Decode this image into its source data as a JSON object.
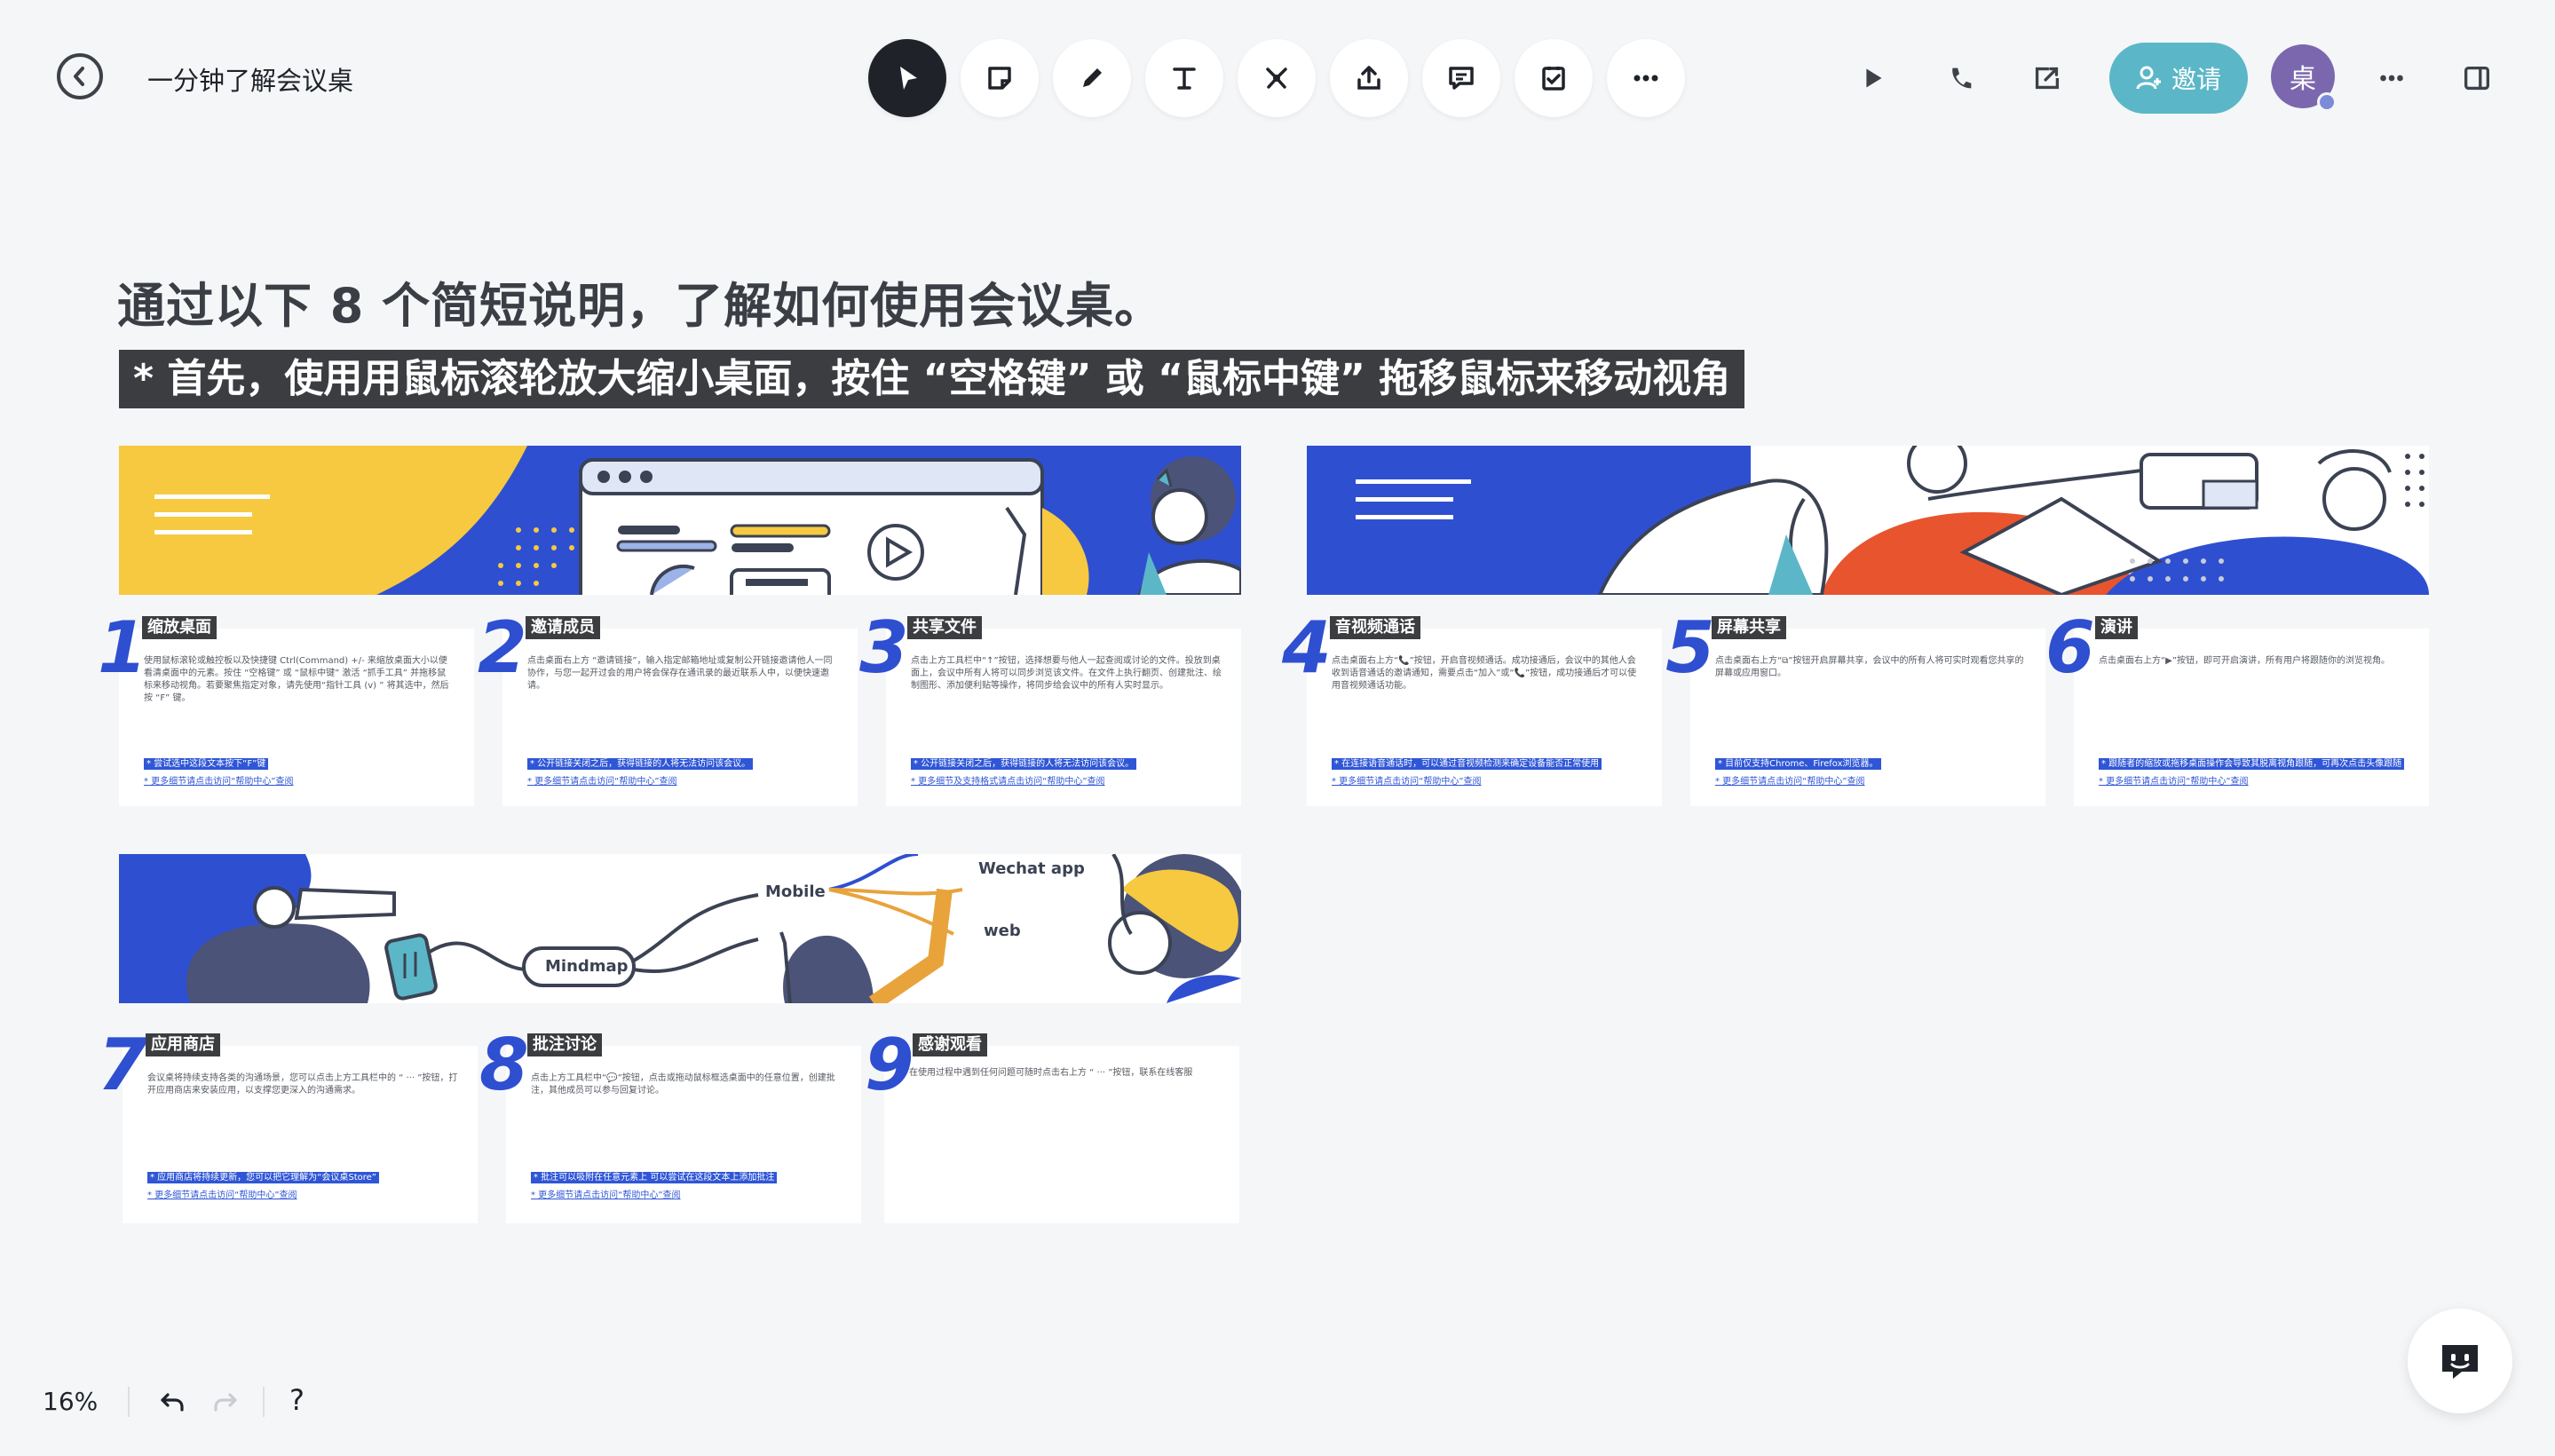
{
  "header": {
    "doc_title": "一分钟了解会议桌",
    "invite_label": "邀请",
    "avatar_char": "桌"
  },
  "toolbar": {
    "tools": [
      "pointer-icon",
      "sticky-note-icon",
      "pen-icon",
      "text-icon",
      "connector-icon",
      "upload-icon",
      "comment-icon",
      "checklist-icon",
      "more-icon"
    ]
  },
  "intro": {
    "headline": "通过以下 8 个简短说明，了解如何使用会议桌。",
    "tip": "* 首先，使用用鼠标滚轮放大缩小桌面，按住 “空格键” 或 “鼠标中键” 拖移鼠标来移动视角"
  },
  "banners": {
    "mindmap_labels": {
      "center": "Mindmap",
      "mobile": "Mobile",
      "wechat": "Wechat app",
      "web": "web"
    }
  },
  "cards": [
    {
      "num": "1",
      "title": "缩放桌面",
      "desc": "使用鼠标滚轮或触控板以及快捷键 Ctrl(Command) +/- 来缩放桌面大小以便看清桌面中的元素。按住 “空格键” 或 “鼠标中键” 激活 “抓手工具” 并拖移鼠标来移动视角。若要聚焦指定对象，请先使用“指针工具 (v) ” 将其选中，然后按 “F” 键。",
      "hl": "* 尝试选中这段文本按下“F”键",
      "link": "* 更多细节请点击访问“帮助中心”查阅"
    },
    {
      "num": "2",
      "title": "邀请成员",
      "desc": "点击桌面右上方 “邀请链接”，输入指定邮箱地址或复制公开链接邀请他人一同协作，与您一起开过会的用户将会保存在通讯录的最近联系人中，以便快速邀请。",
      "hl": "* 公开链接关闭之后，获得链接的人将无法访问该会议。",
      "link": "* 更多细节请点击访问“帮助中心”查阅"
    },
    {
      "num": "3",
      "title": "共享文件",
      "desc": "点击上方工具栏中“↑”按钮，选择想要与他人一起查阅或讨论的文件。投放到桌面上，会议中所有人将可以同步浏览该文件。在文件上执行翻页、创建批注、绘制图形、添加便利贴等操作，将同步给会议中的所有人实时显示。",
      "hl": "* 公开链接关闭之后，获得链接的人将无法访问该会议。",
      "link": "* 更多细节及支持格式请点击访问“帮助中心”查阅"
    },
    {
      "num": "4",
      "title": "音视频通话",
      "desc": "点击桌面右上方“📞”按钮，开启音视频通话。成功接通后，会议中的其他人会收到语音通话的邀请通知，需要点击“加入”或“📞”按钮，成功接通后才可以使用音视频通话功能。",
      "hl": "* 在连接语音通话时，可以通过音视频检测来确定设备能否正常使用",
      "link": "* 更多细节请点击访问“帮助中心”查阅"
    },
    {
      "num": "5",
      "title": "屏幕共享",
      "desc": "点击桌面右上方“⧉”按钮开启屏幕共享，会议中的所有人将可实时观看您共享的屏幕或应用窗口。",
      "hl": "* 目前仅支持Chrome、Firefox浏览器。",
      "link": "* 更多细节请点击访问“帮助中心”查阅"
    },
    {
      "num": "6",
      "title": "演讲",
      "desc": "点击桌面右上方“▶”按钮，即可开启演讲，所有用户将跟随你的浏览视角。",
      "hl": "* 跟随者的缩放或拖移桌面操作会导致其脱离视角跟随，可再次点击头像跟随",
      "link": "* 更多细节请点击访问“帮助中心”查阅"
    },
    {
      "num": "7",
      "title": "应用商店",
      "desc": "会议桌将持续支持各类的沟通场景，您可以点击上方工具栏中的 “ ··· ”按钮，打开应用商店来安装应用，以支撑您更深入的沟通需求。",
      "hl": "* 应用商店将持续更新，您可以把它理解为“会议桌Store”",
      "link": "* 更多细节请点击访问“帮助中心”查阅"
    },
    {
      "num": "8",
      "title": "批注讨论",
      "desc": "点击上方工具栏中“💬”按钮，点击或拖动鼠标框选桌面中的任意位置，创建批注，其他成员可以参与回复讨论。",
      "hl": "* 批注可以吸附在任意元素上 可以尝试在这段文本上添加批注",
      "link": "* 更多细节请点击访问“帮助中心”查阅"
    },
    {
      "num": "9",
      "title": "感谢观看",
      "desc": "在使用过程中遇到任何问题可随时点击右上方 “ ··· ”按钮，联系在线客服",
      "hl": "",
      "link": ""
    }
  ],
  "bottom": {
    "zoom": "16%",
    "help": "?"
  },
  "colors": {
    "accent_blue": "#2f4fd1",
    "invite_teal": "#5bb7c8",
    "avatar_purple": "#7b67ae",
    "banner_yellow": "#f6c940",
    "banner_orange": "#e8542e"
  }
}
